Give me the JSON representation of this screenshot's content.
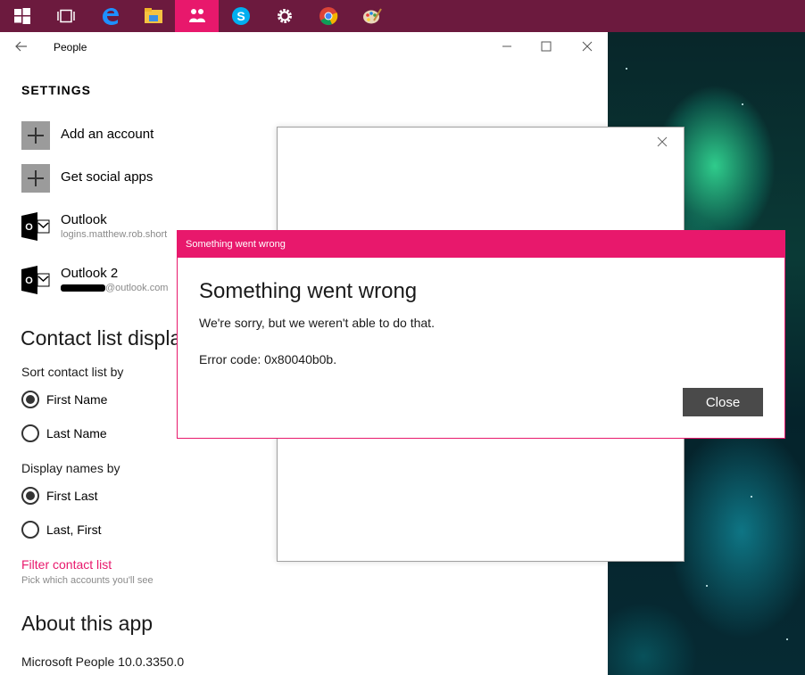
{
  "taskbar": {
    "items": [
      "windows-start",
      "task-view",
      "edge",
      "file-explorer",
      "people",
      "skype",
      "settings",
      "chrome",
      "paint"
    ],
    "active": "people",
    "color": "#6c1a3e",
    "active_color": "#e8186c"
  },
  "window": {
    "title": "People"
  },
  "settings": {
    "heading": "SETTINGS",
    "add_account": "Add an account",
    "get_social_apps": "Get social apps",
    "accounts": [
      {
        "name": "Outlook",
        "email": "logins.matthew.rob.short"
      },
      {
        "name": "Outlook 2",
        "email_suffix": "@outlook.com"
      }
    ]
  },
  "contact_list": {
    "heading": "Contact list displa",
    "sort_label": "Sort contact list by",
    "sort_options": [
      "First Name",
      "Last Name"
    ],
    "sort_selected": "First Name",
    "display_label": "Display names by",
    "display_options": [
      "First Last",
      "Last, First"
    ],
    "display_selected": "First Last",
    "filter_link": "Filter contact list",
    "filter_desc": "Pick which accounts you'll see"
  },
  "about": {
    "heading": "About this app",
    "version": "Microsoft People 10.0.3350.0"
  },
  "error_dialog": {
    "title_bar": "Something went wrong",
    "heading": "Something went wrong",
    "message": "We're sorry, but we weren't able to do that.",
    "error_code": "Error code: 0x80040b0b.",
    "close_label": "Close",
    "accent": "#e8186c"
  }
}
